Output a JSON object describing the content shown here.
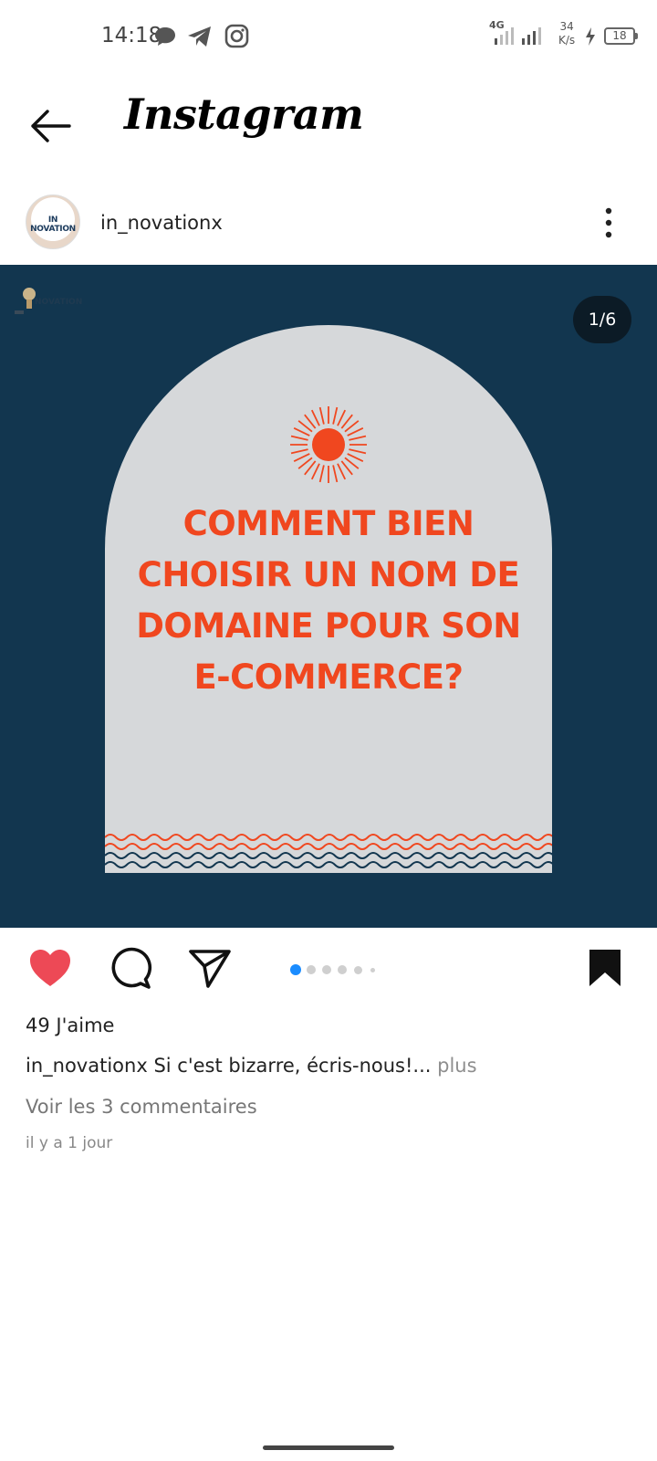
{
  "status_bar": {
    "time": "14:18",
    "network": "4G",
    "speed_value": "34",
    "speed_unit": "K/s",
    "battery": "18",
    "icons": [
      "chat-bubble-icon",
      "telegram-icon",
      "instagram-icon",
      "signal-icon",
      "charging-icon",
      "battery-icon"
    ]
  },
  "header": {
    "title": "Instagram",
    "back_icon": "back-arrow-icon"
  },
  "post": {
    "username": "in_novationx",
    "avatar_text": "IN NOVATION",
    "watermark_text": "NOVATION",
    "counter": "1/6",
    "headline": [
      "COMMENT BIEN",
      "CHOISIR UN NOM DE",
      "DOMAINE POUR SON",
      "E-COMMERCE?"
    ],
    "colors": {
      "background": "#12364f",
      "arch": "#d6d8da",
      "headline": "#f0471f",
      "like": "#ed4956",
      "active_dot": "#1a8cff"
    },
    "carousel": {
      "total": 6,
      "active_index": 0
    }
  },
  "actions": {
    "liked": true,
    "icons": [
      "heart-icon",
      "comment-icon",
      "share-icon",
      "bookmark-icon"
    ]
  },
  "meta": {
    "likes": "49 J'aime",
    "caption_user": "in_novationx",
    "caption_text": " Si c'est bizarre, écris-nous!...",
    "caption_more": " plus",
    "comments_link": "Voir les 3 commentaires",
    "time_ago": "il y a 1 jour"
  }
}
